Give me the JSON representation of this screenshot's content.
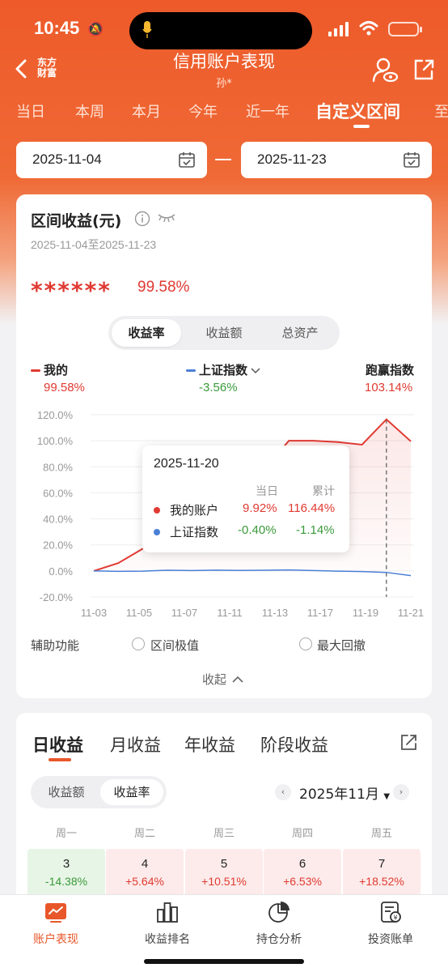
{
  "status_bar": {
    "time": "10:45"
  },
  "header": {
    "logo": "东方财富",
    "title": "信用账户表现",
    "subtitle": "孙*"
  },
  "tabs": [
    {
      "label": "当日"
    },
    {
      "label": "本周"
    },
    {
      "label": "本月"
    },
    {
      "label": "今年"
    },
    {
      "label": "近一年"
    },
    {
      "label": "自定义区间",
      "active": true
    },
    {
      "label": "至"
    }
  ],
  "date_range": {
    "start": "2025-11-04",
    "end": "2025-11-23"
  },
  "summary": {
    "title": "区间收益(元)",
    "range_text": "2025-11-04至2025-11-23",
    "masked_value": "******",
    "return_pct": "99.58%",
    "segments": [
      "收益率",
      "收益额",
      "总资产"
    ],
    "selected_segment": "收益率"
  },
  "legend": {
    "mine": {
      "name": "我的",
      "value": "99.58%"
    },
    "index": {
      "name": "上证指数",
      "value": "-3.56%"
    },
    "beat": {
      "name": "跑赢指数",
      "value": "103.14%"
    }
  },
  "colors": {
    "up": "#e03a32",
    "down": "#3a9a3a",
    "index": "#4a7fd6",
    "accent": "#e8572a"
  },
  "chart_data": {
    "type": "line",
    "x_ticks": [
      "11-03",
      "11-05",
      "11-07",
      "11-11",
      "11-13",
      "11-17",
      "11-19",
      "11-21"
    ],
    "y_ticks": [
      "120.0%",
      "100.0%",
      "80.0%",
      "60.0%",
      "40.0%",
      "20.0%",
      "0.0%",
      "-20.0%"
    ],
    "ylim": [
      -20,
      120
    ],
    "series": [
      {
        "name": "我的账户",
        "values": [
          0,
          6,
          17,
          26,
          38,
          50,
          63,
          78,
          100,
          100,
          99,
          97,
          116.44,
          99.58
        ]
      },
      {
        "name": "上证指数",
        "values": [
          0,
          -0.3,
          -0.2,
          0.5,
          0.3,
          0.6,
          0.4,
          0.5,
          0.8,
          0.3,
          -0.2,
          -0.5,
          -1.14,
          -3.56
        ]
      }
    ],
    "crosshair_index": 12
  },
  "tooltip": {
    "date": "2025-11-20",
    "col_day": "当日",
    "col_total": "累计",
    "rows": [
      {
        "name": "我的账户",
        "day": "9.92%",
        "total": "116.44%"
      },
      {
        "name": "上证指数",
        "day": "-0.40%",
        "total": "-1.14%"
      }
    ]
  },
  "aux": {
    "label": "辅助功能",
    "option1": "区间极值",
    "option2": "最大回撤",
    "collapse": "收起"
  },
  "period_tabs": [
    "日收益",
    "月收益",
    "年收益",
    "阶段收益"
  ],
  "calendar": {
    "toggle": [
      "收益额",
      "收益率"
    ],
    "selected_toggle": "收益率",
    "month": "2025年11月",
    "weekdays": [
      "周一",
      "周二",
      "周三",
      "周四",
      "周五"
    ],
    "days": [
      {
        "day": "3",
        "pct": "-14.38%",
        "dir": "down"
      },
      {
        "day": "4",
        "pct": "+5.64%",
        "dir": "up"
      },
      {
        "day": "5",
        "pct": "+10.51%",
        "dir": "up"
      },
      {
        "day": "6",
        "pct": "+6.53%",
        "dir": "up"
      },
      {
        "day": "7",
        "pct": "+18.52%",
        "dir": "up"
      }
    ]
  },
  "bottom_nav": [
    {
      "label": "账户表现",
      "icon": "chart-icon",
      "active": true
    },
    {
      "label": "收益排名",
      "icon": "bars-icon"
    },
    {
      "label": "持仓分析",
      "icon": "pie-icon"
    },
    {
      "label": "投资账单",
      "icon": "bill-icon"
    }
  ]
}
